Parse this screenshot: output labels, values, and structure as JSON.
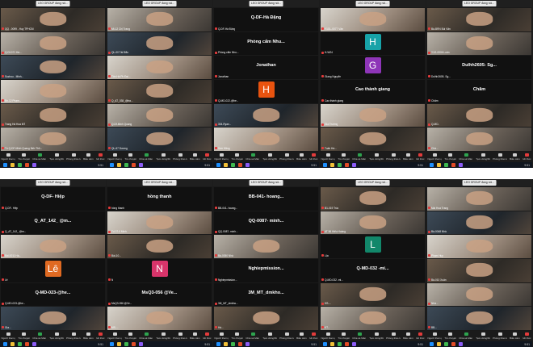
{
  "banner": "LEO GROUP đang nói...",
  "toolbar": [
    {
      "label": "Người tham gia",
      "icon": "participants-icon"
    },
    {
      "label": "Trò chuyện",
      "icon": "chat-icon"
    },
    {
      "label": "Chia sẻ Màn hình",
      "icon": "share-screen-icon",
      "accent": "green"
    },
    {
      "label": "Tạm dừng/Dừng ghi hình",
      "icon": "record-icon"
    },
    {
      "label": "Phòng thảo luận",
      "icon": "breakout-icon"
    },
    {
      "label": "Biểu cảm",
      "icon": "reactions-icon"
    },
    {
      "label": "Kết thúc",
      "icon": "end-icon",
      "accent": "red"
    }
  ],
  "clock": "9:51",
  "screens": [
    {
      "windows": [
        {
          "tiles": [
            {
              "type": "video",
              "label": "QQ - 0099 - Huy TPHCM"
            },
            {
              "type": "video",
              "label": "Q-Df-071 Hà..."
            },
            {
              "type": "video",
              "label": "Suzhou - Minh..."
            },
            {
              "type": "video",
              "label": "Bn-12 Phạm..."
            },
            {
              "type": "video",
              "label": "Trang Hà Hoa MT"
            },
            {
              "type": "video",
              "label": "Tú Q-DF-Minh Quang Bến Thỏ..."
            }
          ]
        },
        {
          "tiles": [
            {
              "type": "video",
              "label": "Mt-12 Chị Trang"
            },
            {
              "type": "video",
              "label": "QL-00 Tài Đẩu"
            },
            {
              "type": "video",
              "label": "Tân Hà Ph Đại..."
            },
            {
              "type": "video",
              "label": "Q_AT_038_@tra..."
            },
            {
              "type": "video",
              "label": "Q-Df-Minh Quang"
            },
            {
              "type": "video",
              "label": "QL-67 Dương"
            }
          ]
        },
        {
          "tiles": [
            {
              "type": "name",
              "name": "Q-DF-Hà Đặng",
              "label": "Q-DF-Hà Đặng"
            },
            {
              "type": "name",
              "name": "Phòng cẩm Nhu...",
              "label": "Phòng cẩm Nhu..."
            },
            {
              "type": "name",
              "name": "Jonathan",
              "label": "Jonathan"
            },
            {
              "type": "avatar",
              "letter": "H",
              "color": "#e8530f",
              "label": "Q-MD-022-@he..."
            },
            {
              "type": "video",
              "label": "304-Ryan..."
            },
            {
              "type": "video",
              "label": "Sơn Hằng"
            }
          ]
        },
        {
          "tiles": [
            {
              "type": "video",
              "label": "Y1GL-0077 Vân"
            },
            {
              "type": "avatar",
              "letter": "H",
              "color": "#17a3a8",
              "label": "H-W24"
            },
            {
              "type": "avatar",
              "letter": "G",
              "color": "#8e35b8",
              "label": "Giang Nguyễn"
            },
            {
              "type": "name",
              "name": "Cao thành giang",
              "label": "Cao thành giang"
            },
            {
              "type": "video",
              "label": "Gia Trường"
            },
            {
              "type": "video",
              "label": "Tuấn Hà..."
            }
          ]
        },
        {
          "tiles": [
            {
              "type": "video",
              "label": "Bà-BRN Bùi Văn"
            },
            {
              "type": "video",
              "label": "Y1G-0006 Luân"
            },
            {
              "type": "name",
              "name": "Dulhh2605- Sg...",
              "label": "Dulhh2605- Sg..."
            },
            {
              "type": "name",
              "name": "Chăm",
              "label": "Chăm"
            },
            {
              "type": "video",
              "label": "Q-MD-"
            },
            {
              "type": "video",
              "label": "Chà..."
            }
          ]
        }
      ]
    },
    {
      "windows": [
        {
          "tiles": [
            {
              "type": "name",
              "name": "Q-DF- Hiệp",
              "label": "Q-DF- Hiệp"
            },
            {
              "type": "name",
              "name": "Q_AT_142_ @m...",
              "label": "Q_AT_142_ @m..."
            },
            {
              "type": "video",
              "label": "Bài-0011 Hà..."
            },
            {
              "type": "avatar",
              "letter": "Lê",
              "color": "#e06a22",
              "label": "Lê"
            },
            {
              "type": "name",
              "name": "Q-MD-023-@he...",
              "label": "Q-MD-023-@he..."
            },
            {
              "type": "video",
              "label": "Gia..."
            }
          ]
        },
        {
          "tiles": [
            {
              "type": "name",
              "name": "hồng thanh",
              "label": "hồng thanh"
            },
            {
              "type": "video",
              "label": "Tố 07-0 Minh"
            },
            {
              "type": "video",
              "label": "Bài-10..."
            },
            {
              "type": "avatar",
              "letter": "N",
              "color": "#d8346a",
              "label": "N"
            },
            {
              "type": "name",
              "name": "MsQ3-056 @Ve...",
              "label": "MsQ3-056 @Ve..."
            },
            {
              "type": "video",
              "label": "MS-..."
            }
          ]
        },
        {
          "tiles": [
            {
              "type": "name",
              "name": "BB-041- hoang...",
              "label": "BB-041- hoang..."
            },
            {
              "type": "name",
              "name": "QQ-0087- minh...",
              "label": "QQ-0087- minh..."
            },
            {
              "type": "video",
              "label": "Bà-0050 Nhà"
            },
            {
              "type": "name",
              "name": "Nghiepmission...",
              "label": "Nghiepmission..."
            },
            {
              "type": "name",
              "name": "3M_MT_dmkho...",
              "label": "3M_MT_dmkho..."
            },
            {
              "type": "video",
              "label": "Hà..."
            }
          ]
        },
        {
          "tiles": [
            {
              "type": "video",
              "label": "B1-019 Trúc"
            },
            {
              "type": "video",
              "label": "AT 56 Hiếu Hoàng"
            },
            {
              "type": "avatar",
              "letter": "L",
              "color": "#12876a",
              "label": "Lộc"
            },
            {
              "type": "name",
              "name": "Q-MD-032 -mi...",
              "label": "Q-MD-032 -mi..."
            },
            {
              "type": "video",
              "label": "HS-..."
            },
            {
              "type": "video",
              "label": "KT..."
            }
          ]
        },
        {
          "tiles": [
            {
              "type": "video",
              "label": "Mai Hoa Trang"
            },
            {
              "type": "video",
              "label": "Bà-0048 Nhà"
            },
            {
              "type": "video",
              "label": "Phạm Huy"
            },
            {
              "type": "video",
              "label": "Bà-010 Xuân"
            },
            {
              "type": "video",
              "label": "Nhà..."
            },
            {
              "type": "video",
              "label": "BB..."
            }
          ]
        }
      ]
    }
  ]
}
